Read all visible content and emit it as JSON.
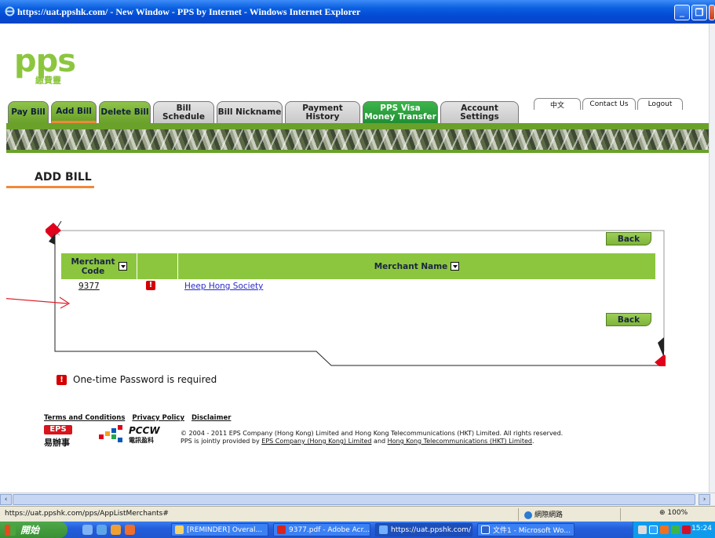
{
  "window": {
    "title": "https://uat.ppshk.com/ - New Window - PPS by Internet - Windows Internet Explorer",
    "minimize": "_",
    "maximize": "❐",
    "close": "X"
  },
  "logo": {
    "text": "pps",
    "subtitle": "繳費靈"
  },
  "tabs": [
    {
      "label": "Pay Bill"
    },
    {
      "label": "Add Bill"
    },
    {
      "label": "Delete Bill"
    },
    {
      "label": "Bill Schedule"
    },
    {
      "label": "Bill Nickname"
    },
    {
      "label": "Payment History"
    },
    {
      "label": "PPS Visa\nMoney Transfer"
    },
    {
      "label": "Account Settings"
    }
  ],
  "toplinks": {
    "chinese": "中文",
    "contact": "Contact Us",
    "logout": "Logout"
  },
  "page": {
    "heading": "ADD BILL"
  },
  "buttons": {
    "back_top": "Back",
    "back_bottom": "Back"
  },
  "table": {
    "headers": {
      "merchant_code": "Merchant\nCode",
      "merchant_name": "Merchant Name"
    },
    "rows": [
      {
        "code": "9377",
        "otp_flag": "!",
        "name": "Heep Hong Society"
      }
    ]
  },
  "footnote": {
    "icon": "!",
    "text": "One-time Password is required"
  },
  "footer": {
    "links": [
      "Terms and Conditions",
      "Privacy Policy",
      "Disclaimer"
    ],
    "eps_logo": "EPS",
    "eps_cn": "易辦事",
    "pccw_logo": "PCCW",
    "pccw_cn": "電訊盈科",
    "copyright_line1": "© 2004 - 2011 EPS Company (Hong Kong) Limited and Hong Kong Telecommunications (HKT) Limited. All rights reserved.",
    "copyright_line2_pre": "PPS is jointly provided by ",
    "copyright_link1": "EPS Company (Hong Kong) Limited",
    "copyright_line2_mid": " and ",
    "copyright_link2": "Hong Kong Telecommunications (HKT) Limited",
    "copyright_line2_end": "."
  },
  "statusbar": {
    "url": "https://uat.ppshk.com/pps/AppListMerchants#",
    "zone": "網際網路",
    "zoom": "100%"
  },
  "taskbar": {
    "start": "開始",
    "tasks": [
      "[REMINDER] Overal...",
      "9377.pdf - Adobe Acr...",
      "https://uat.ppshk.com/ ...",
      "文件1 - Microsoft Wo..."
    ],
    "clock": "15:24"
  },
  "colors": {
    "brand_green": "#8cc63f",
    "accent_orange": "#f0883a",
    "otp_red": "#d40000"
  }
}
